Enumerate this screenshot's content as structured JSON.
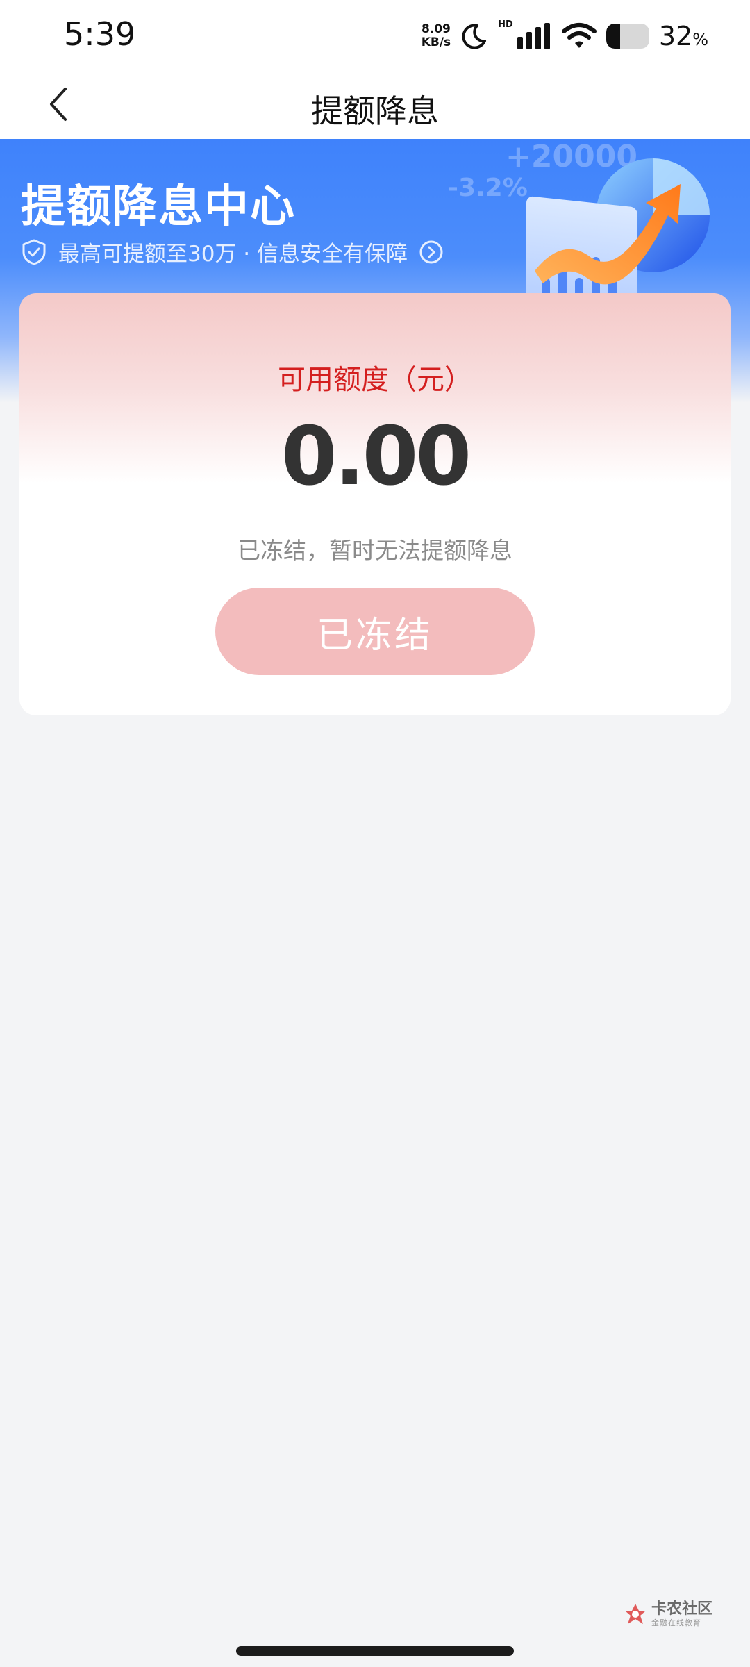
{
  "status_bar": {
    "time": "5:39",
    "net_speed_value": "8.09",
    "net_speed_unit": "KB/s",
    "hd_label": "HD",
    "battery_percent": "32",
    "battery_unit": "%",
    "battery_level": 0.32
  },
  "nav": {
    "title": "提额降息"
  },
  "hero": {
    "title": "提额降息中心",
    "subtitle": "最高可提额至30万 · 信息安全有保障",
    "deco_number_1": "+20000",
    "deco_number_2": "-3.2%",
    "accent_color": "#3f82fb"
  },
  "card": {
    "credit_label": "可用额度（元）",
    "credit_amount": "0.00",
    "status_text": "已冻结，暂时无法提额降息",
    "button_label": "已冻结",
    "label_color": "#d41f1f",
    "button_color": "#f3bcbd"
  },
  "watermark": {
    "title": "卡农社区",
    "subtitle": "金融在线教育"
  },
  "icons": [
    "back-arrow-icon",
    "moon-icon",
    "signal-icon",
    "wifi-icon",
    "battery-icon",
    "shield-check-icon",
    "chevron-right-circle-icon",
    "growth-chart-illustration",
    "kanong-logo-icon"
  ]
}
